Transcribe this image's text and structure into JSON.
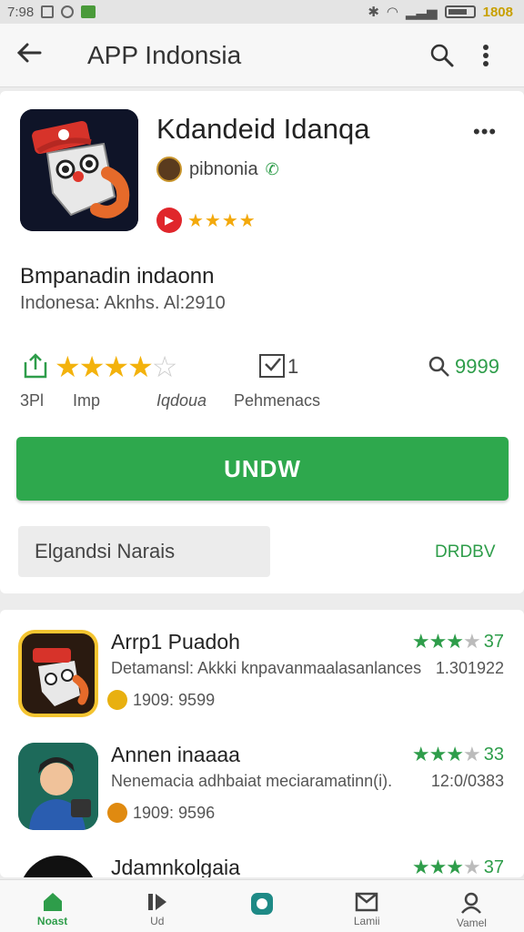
{
  "status_bar": {
    "left_text": "7:98",
    "right_text": "1808"
  },
  "toolbar": {
    "title": "APP Indonsia"
  },
  "app": {
    "name": "Kdandeid Idanqa",
    "developer": "pibnonia",
    "description_title": "Bmpanadin indaonn",
    "description_sub": "Indonesa: Aknhs. Al:2910",
    "stat1_label": "3Pl",
    "stat2_label": "Imp",
    "stat3_label": "Iqdoua",
    "stat4_label": "Pehmenacs",
    "review_count": "1",
    "search_count": "9999",
    "star_rating": 4,
    "install_label": "UNDW",
    "secondary_label": "Elgandsi Narais",
    "more_label": "DRDBV"
  },
  "list": [
    {
      "title": "Arrp1 Puadoh",
      "description": "Detamansl: Akkki knpavanmaalasanlances",
      "rating": "37",
      "date": "1.301922",
      "meta": "1909: 9599"
    },
    {
      "title": "Annen inaaaa",
      "description": "Nenemacia adhbaiat meciaramatinn(i).",
      "rating": "33",
      "date": "12:0/0383",
      "meta": "1909: 9596"
    },
    {
      "title": "Jdamnkolgaia",
      "description": "",
      "rating": "37",
      "date": "",
      "meta": ""
    }
  ],
  "bottom_nav": [
    {
      "label": "Noast",
      "icon": "home-icon",
      "active": true
    },
    {
      "label": "Ud",
      "icon": "media-icon",
      "active": false
    },
    {
      "label": "",
      "icon": "app-center-icon",
      "active": false
    },
    {
      "label": "Lamii",
      "icon": "library-icon",
      "active": false
    },
    {
      "label": "Vamel",
      "icon": "profile-icon",
      "active": false
    }
  ],
  "colors": {
    "accent": "#2ea84d",
    "star": "#f3b20c",
    "badge": "#e0262b"
  }
}
